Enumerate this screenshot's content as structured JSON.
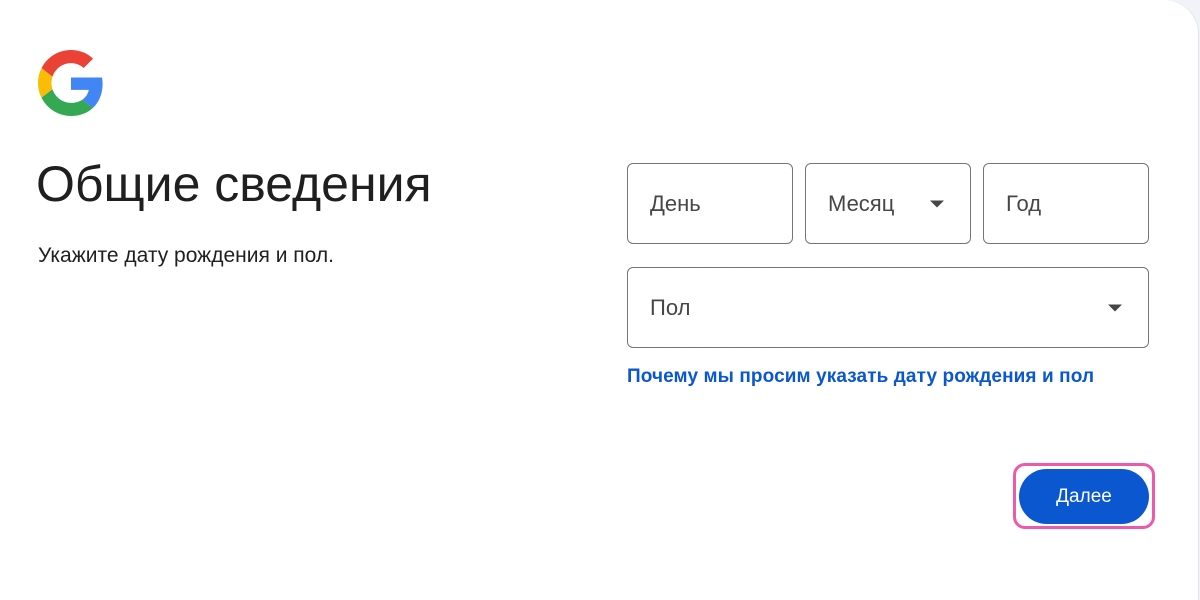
{
  "header": {
    "logo_icon": "google-g-logo",
    "title": "Общие сведения",
    "subtitle": "Укажите дату рождения и пол."
  },
  "form": {
    "birthday": {
      "day": {
        "placeholder": "День",
        "value": ""
      },
      "month": {
        "placeholder": "Месяц",
        "value": "",
        "icon": "chevron-down-icon"
      },
      "year": {
        "placeholder": "Год",
        "value": ""
      }
    },
    "gender": {
      "placeholder": "Пол",
      "value": "",
      "icon": "chevron-down-icon"
    },
    "help_link": "Почему мы просим указать дату рождения и пол"
  },
  "actions": {
    "next_label": "Далее",
    "highlight_color": "#ec5ba7"
  },
  "colors": {
    "primary": "#0b57d0",
    "text": "#1f1f1f",
    "field_border": "#747775",
    "background": "#f0f4f9"
  }
}
